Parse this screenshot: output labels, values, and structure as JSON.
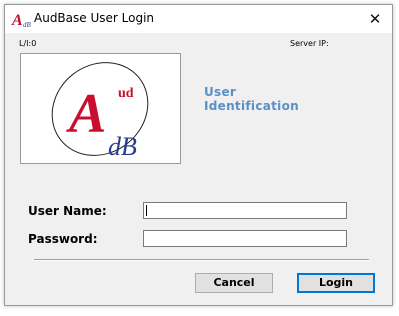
{
  "window": {
    "title": "AudBase User Login",
    "close_glyph": "✕",
    "app_icon": "audbase-logo-icon"
  },
  "status": {
    "left": "L/I:0",
    "right": "Server IP:"
  },
  "logo": {
    "big_letter": "A",
    "superscript": "ud",
    "subscript": "dB",
    "colors": {
      "letter_red": "#c8102e",
      "letter_blue": "#2a3d8f"
    }
  },
  "identification": {
    "line1": "User",
    "line2": "Identification",
    "color": "#5b8fc9"
  },
  "form": {
    "username_label": "User Name:",
    "username_value": "",
    "password_label": "Password:",
    "password_value": ""
  },
  "buttons": {
    "cancel": "Cancel",
    "login": "Login"
  }
}
